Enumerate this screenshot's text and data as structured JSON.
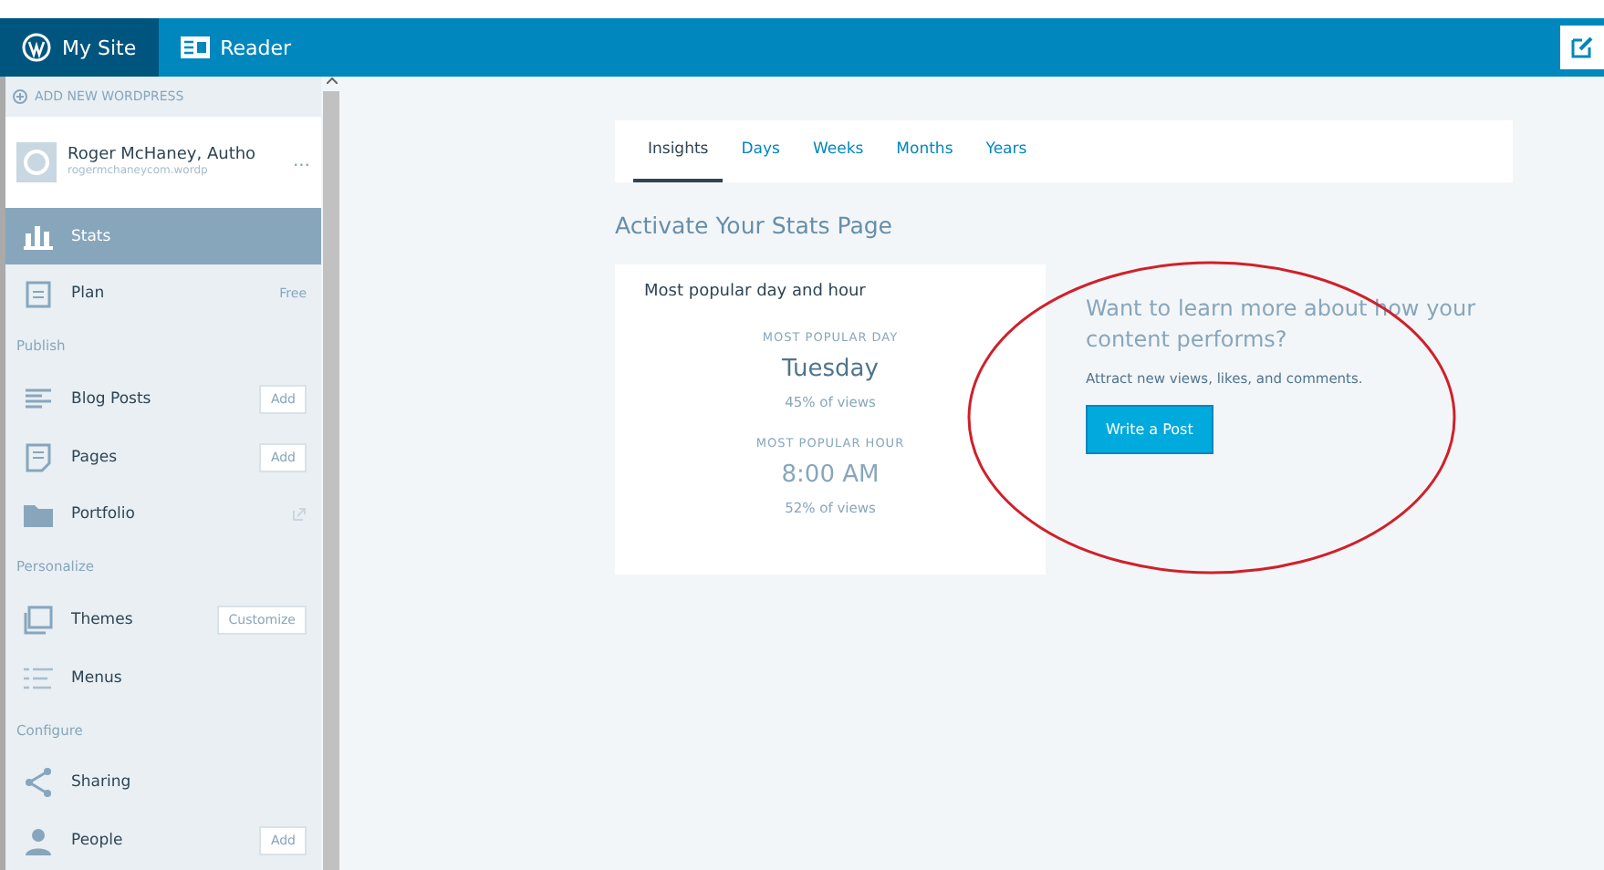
{
  "top_bar": {
    "tabs": [
      {
        "label": "My Site",
        "selected": true
      },
      {
        "label": "Reader",
        "selected": false
      }
    ]
  },
  "sidebar": {
    "add_site": "ADD NEW WORDPRESS",
    "site": {
      "title": "Roger McHaney, Autho",
      "url": "rogermchaneycom.wordp",
      "menu": "..."
    },
    "items": [
      {
        "kind": "item",
        "label": "Stats",
        "selected": true
      },
      {
        "kind": "item",
        "label": "Plan",
        "selected": false,
        "badge": "Free"
      },
      {
        "kind": "heading",
        "label": "Publish"
      },
      {
        "kind": "item",
        "label": "Blog Posts",
        "selected": false,
        "action": "Add"
      },
      {
        "kind": "item",
        "label": "Pages",
        "selected": false,
        "action": "Add"
      },
      {
        "kind": "item",
        "label": "Portfolio",
        "selected": false,
        "external": true
      },
      {
        "kind": "heading",
        "label": "Personalize"
      },
      {
        "kind": "item",
        "label": "Themes",
        "selected": false,
        "action": "Customize"
      },
      {
        "kind": "item",
        "label": "Menus",
        "selected": false
      },
      {
        "kind": "heading",
        "label": "Configure"
      },
      {
        "kind": "item",
        "label": "Sharing",
        "selected": false
      },
      {
        "kind": "item",
        "label": "People",
        "selected": false,
        "action": "Add"
      }
    ]
  },
  "tabs": [
    {
      "label": "Insights",
      "selected": true
    },
    {
      "label": "Days",
      "selected": false
    },
    {
      "label": "Weeks",
      "selected": false
    },
    {
      "label": "Months",
      "selected": false
    },
    {
      "label": "Years",
      "selected": false
    }
  ],
  "heading": "Activate Your Stats Page",
  "popular_card": {
    "title": "Most popular day and hour",
    "day_label": "MOST POPULAR DAY",
    "day": "Tuesday",
    "day_share": "45% of views",
    "hour_label": "MOST POPULAR HOUR",
    "hour": "8:00 AM",
    "hour_share": "52% of views"
  },
  "promo": {
    "title": "Want to learn more about how your content performs?",
    "text": "Attract new views, likes, and comments.",
    "button": "Write a Post"
  }
}
